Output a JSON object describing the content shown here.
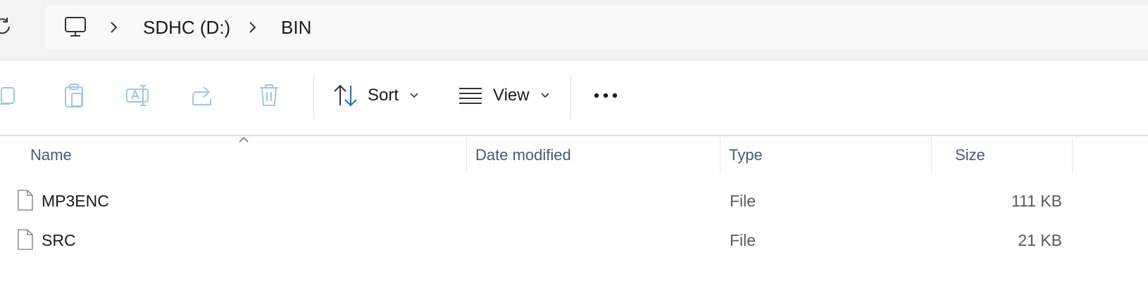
{
  "address_bar": {
    "crumbs": [
      "SDHC (D:)",
      "BIN"
    ],
    "root_icon": "this-pc-icon"
  },
  "command_bar": {
    "sort_label": "Sort",
    "view_label": "View",
    "icons": [
      "copy-icon",
      "paste-icon",
      "rename-icon",
      "share-icon",
      "delete-icon",
      "sort-icon",
      "view-icon",
      "more-icon"
    ]
  },
  "file_list": {
    "columns": [
      "Name",
      "Date modified",
      "Type",
      "Size"
    ],
    "rows": [
      {
        "name": "MP3ENC",
        "date_modified": "",
        "type": "File",
        "size": "111 KB"
      },
      {
        "name": "SRC",
        "date_modified": "",
        "type": "File",
        "size": "21 KB"
      }
    ]
  },
  "colors": {
    "header_text": "#475b74",
    "disabled_icon": "#9ec7ea",
    "accent": "#1f6fc5"
  }
}
